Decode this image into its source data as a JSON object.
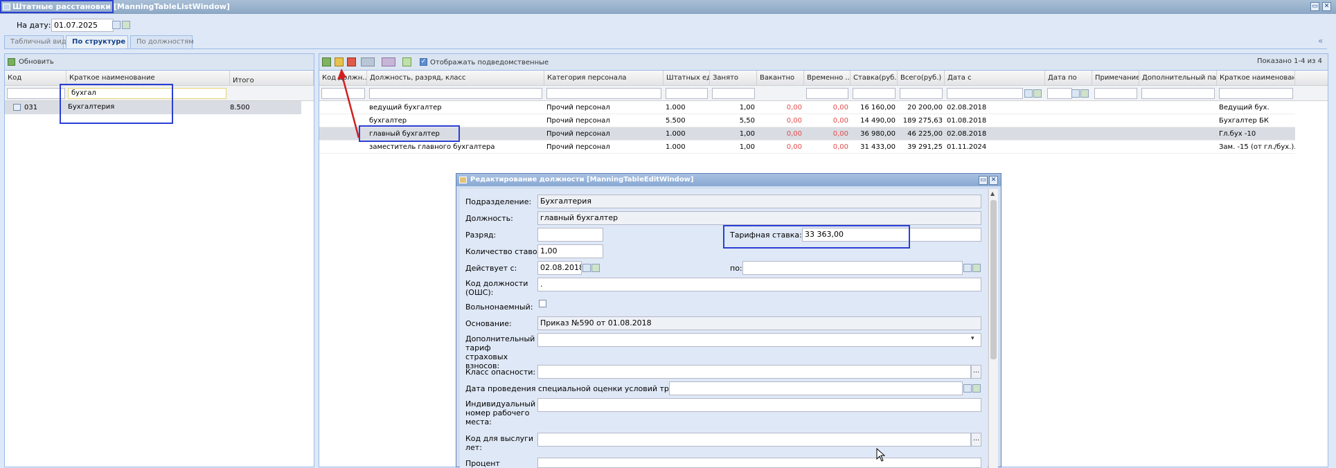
{
  "window": {
    "title": "Штатные расстановки [ManningTableListWindow]"
  },
  "date_bar": {
    "label": "На дату:",
    "value": "01.07.2025"
  },
  "tabs": [
    {
      "label": "Табличный вид"
    },
    {
      "label": "По структуре"
    },
    {
      "label": "По должностям"
    }
  ],
  "left_panel": {
    "refresh_label": "Обновить",
    "columns": [
      "Код",
      "Краткое наименование",
      "Итого"
    ],
    "filter_value": "бухгал",
    "rows": [
      {
        "code": "031",
        "name": "Бухгалтерия",
        "total": "8.500"
      }
    ]
  },
  "right_panel": {
    "show_subordinate_label": "Отображать подведомственные",
    "shown_text": "Показано 1-4 из 4",
    "columns": [
      "Код должн...",
      "Должность, разряд, класс",
      "Категория персонала",
      "Штатных ед.",
      "Занято",
      "Вакантно",
      "Временно ...",
      "Ставка(руб.)",
      "Всего(руб.)",
      "Дата с",
      "Дата по",
      "Примечание",
      "Дополнительный па...",
      "Краткое наименован..."
    ],
    "rows": [
      {
        "position": "ведущий бухгалтер",
        "category": "Прочий персонал",
        "units": "1.000",
        "occupied": "1,00",
        "vacant": "0,00",
        "temp": "0,00",
        "rate": "16 160,00",
        "total": "20 200,00",
        "date_from": "02.08.2018",
        "short": "Ведущий бух."
      },
      {
        "position": "бухгалтер",
        "category": "Прочий персонал",
        "units": "5.500",
        "occupied": "5,50",
        "vacant": "0,00",
        "temp": "0,00",
        "rate": "14 490,00",
        "total": "189 275,63",
        "date_from": "01.08.2018",
        "short": "Бухгалтер БК"
      },
      {
        "position": "главный бухгалтер",
        "category": "Прочий персонал",
        "units": "1.000",
        "occupied": "1,00",
        "vacant": "0,00",
        "temp": "0,00",
        "rate": "36 980,00",
        "total": "46 225,00",
        "date_from": "02.08.2018",
        "short": "Гл.бух -10"
      },
      {
        "position": "заместитель главного бухгалтера",
        "category": "Прочий персонал",
        "units": "1.000",
        "occupied": "1,00",
        "vacant": "0,00",
        "temp": "0,00",
        "rate": "31 433,00",
        "total": "39 291,25",
        "date_from": "01.11.2024",
        "short": "Зам. -15 (от гл./бух.)..."
      }
    ]
  },
  "dialog": {
    "title": "Редактирование должности [ManningTableEditWindow]",
    "fields": {
      "division": {
        "label": "Подразделение:",
        "value": "Бухгалтерия"
      },
      "position": {
        "label": "Должность:",
        "value": "главный бухгалтер"
      },
      "grade": {
        "label": "Разряд:",
        "value": ""
      },
      "tariff": {
        "label": "Тарифная ставка:",
        "value": "33 363,00"
      },
      "rate_count": {
        "label": "Количество ставок:",
        "value": "1,00"
      },
      "valid_from": {
        "label": "Действует с:",
        "value": "02.08.2018"
      },
      "valid_to": {
        "label": "по:",
        "value": ""
      },
      "ocs_code": {
        "label": "Код должности (ОШС):",
        "value": "."
      },
      "freelance": {
        "label": "Вольнонаемный:"
      },
      "basis": {
        "label": "Основание:",
        "value": "Приказ №590 от 01.08.2018"
      },
      "extra_tariff": {
        "label": "Дополнительный тариф страховых взносов:",
        "value": ""
      },
      "hazard_class": {
        "label": "Класс опасности:",
        "value": ""
      },
      "assessment_date": {
        "label": "Дата проведения специальной оценки условий труда:",
        "value": ""
      },
      "workplace_number": {
        "label": "Индивидуальный номер рабочего места:",
        "value": ""
      },
      "seniority_code": {
        "label": "Код для выслуги лет:",
        "value": ""
      },
      "percent": {
        "label": "Процент",
        "value": ""
      }
    }
  },
  "colors": {
    "accent_blue": "#2a3fd4",
    "arrow_red": "#d11f1f",
    "vacant_red": "#e34a4a"
  }
}
